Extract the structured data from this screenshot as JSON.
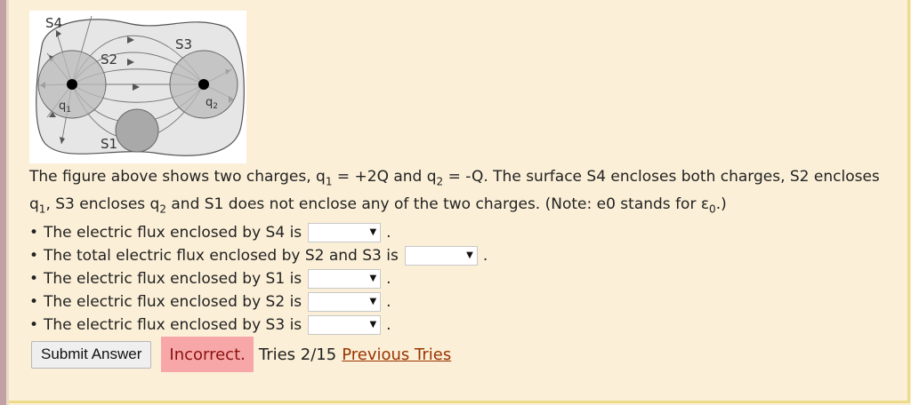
{
  "figure": {
    "labels": {
      "s4": "S4",
      "s3": "S3",
      "s2": "S2",
      "s1": "S1",
      "q1": "q",
      "q1_sub": "1",
      "q2": "q",
      "q2_sub": "2"
    }
  },
  "question": {
    "p1": "The figure above shows two charges, q",
    "p1_sub1": "1",
    "p2": " = +2Q and q",
    "p2_sub2": "2",
    "p3": " = -Q. The surface S4 encloses both charges, S2 encloses q",
    "p3_sub": "1",
    "p4": ", S3 encloses q",
    "p4_sub": "2",
    "p5": " and S1 does not enclose any of the two charges. (Note: e0 stands for ε",
    "p5_sub": "0",
    "p6": ".)"
  },
  "items": [
    {
      "text": "The electric flux enclosed by S4 is",
      "value": "",
      "arrow": "▼"
    },
    {
      "text": "The total electric flux enclosed by S2 and S3 is",
      "value": "",
      "arrow": "▼"
    },
    {
      "text": "The electric flux enclosed by S1 is",
      "value": "",
      "arrow": "▼"
    },
    {
      "text": "The electric flux enclosed by S2 is",
      "value": "",
      "arrow": "▼"
    },
    {
      "text": "The electric flux enclosed by S3 is",
      "value": "",
      "arrow": "▼"
    }
  ],
  "bullet": "•",
  "period": ".",
  "actions": {
    "submit_label": "Submit Answer",
    "status": "Incorrect.",
    "tries": "Tries 2/15",
    "previous_tries": "Previous Tries"
  }
}
